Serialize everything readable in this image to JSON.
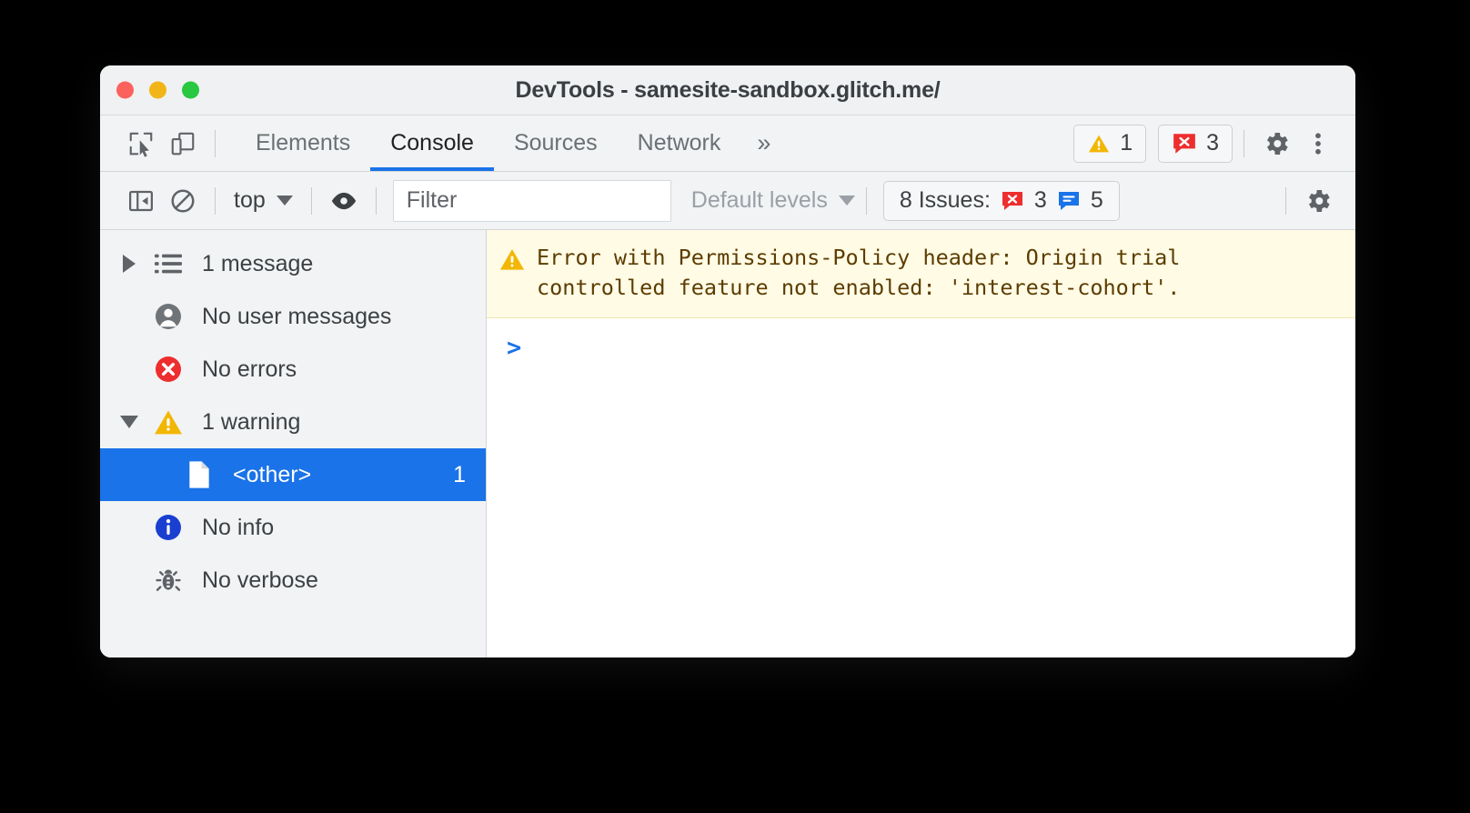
{
  "window": {
    "title": "DevTools - samesite-sandbox.glitch.me/",
    "traffic_lights": {
      "close": "close-window",
      "minimize": "minimize-window",
      "maximize": "maximize-window"
    },
    "colors": {
      "accent": "#1a73e8",
      "warning": "#f2b705",
      "error": "#ee2e2e",
      "info": "#1a73e8",
      "titlebar_bg": "#eff1f2",
      "toolbar_bg": "#f1f3f4",
      "warning_banner_bg": "#fffbe5",
      "traffic_red": "#fc625d",
      "traffic_yellow": "#f2b518",
      "traffic_green": "#28c840"
    }
  },
  "tabbar": {
    "inspect_icon": "inspect-element-icon",
    "device_toggle_icon": "device-toolbar-icon",
    "tabs": [
      {
        "label": "Elements",
        "active": false
      },
      {
        "label": "Console",
        "active": true
      },
      {
        "label": "Sources",
        "active": false
      },
      {
        "label": "Network",
        "active": false
      }
    ],
    "more_tabs_label": "»",
    "warning_count": "1",
    "error_count": "3",
    "settings_icon": "gear-icon",
    "more_options_icon": "more-vertical-icon"
  },
  "console_toolbar": {
    "sidebar_toggle_icon": "console-sidebar-toggle-icon",
    "clear_console_icon": "clear-console-icon",
    "context_label": "top",
    "live_expression_icon": "eye-icon",
    "filter_placeholder": "Filter",
    "filter_value": "",
    "levels_label": "Default levels",
    "issues_label": "8 Issues:",
    "issues_error_count": "3",
    "issues_info_count": "5",
    "settings_icon": "console-settings-gear-icon"
  },
  "sidebar": {
    "items": [
      {
        "label": "1 message",
        "icon": "list-icon",
        "twisty": "collapsed",
        "count": "",
        "selected": false,
        "indent": false
      },
      {
        "label": "No user messages",
        "icon": "user-icon",
        "twisty": "none",
        "count": "",
        "selected": false,
        "indent": false
      },
      {
        "label": "No errors",
        "icon": "error-circle-icon",
        "twisty": "none",
        "count": "",
        "selected": false,
        "indent": false
      },
      {
        "label": "1 warning",
        "icon": "warning-triangle-icon",
        "twisty": "expanded",
        "count": "",
        "selected": false,
        "indent": false
      },
      {
        "label": "<other>",
        "icon": "file-icon",
        "twisty": "none",
        "count": "1",
        "selected": true,
        "indent": true
      },
      {
        "label": "No info",
        "icon": "info-circle-icon",
        "twisty": "none",
        "count": "",
        "selected": false,
        "indent": false
      },
      {
        "label": "No verbose",
        "icon": "bug-icon",
        "twisty": "none",
        "count": "",
        "selected": false,
        "indent": false
      }
    ]
  },
  "console_output": {
    "messages": [
      {
        "level": "warning",
        "icon": "warning-triangle-icon",
        "text": "Error with Permissions-Policy header: Origin trial\ncontrolled feature not enabled: 'interest-cohort'."
      }
    ],
    "prompt_symbol": ">",
    "prompt_value": ""
  }
}
